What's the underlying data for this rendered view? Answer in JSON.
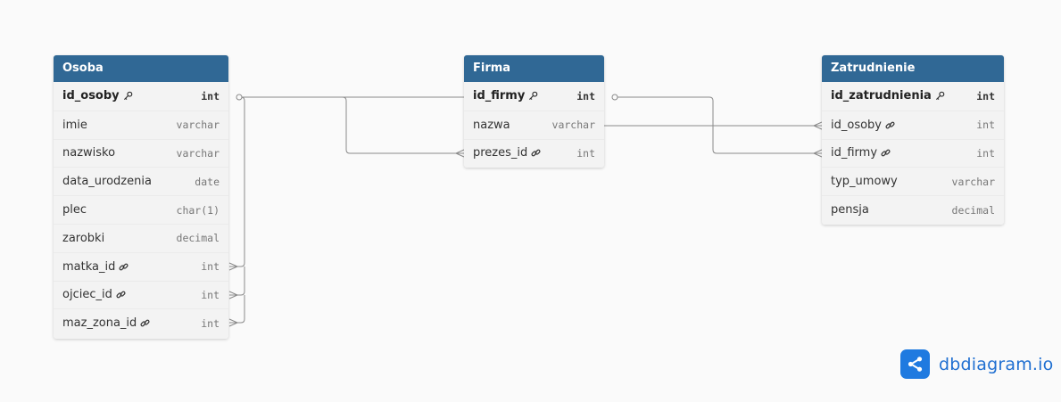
{
  "tables": {
    "osoba": {
      "name": "Osoba",
      "columns": [
        {
          "name": "id_osoby",
          "type": "int",
          "pk": true
        },
        {
          "name": "imie",
          "type": "varchar"
        },
        {
          "name": "nazwisko",
          "type": "varchar"
        },
        {
          "name": "data_urodzenia",
          "type": "date"
        },
        {
          "name": "plec",
          "type": "char(1)"
        },
        {
          "name": "zarobki",
          "type": "decimal"
        },
        {
          "name": "matka_id",
          "type": "int",
          "fk": true
        },
        {
          "name": "ojciec_id",
          "type": "int",
          "fk": true
        },
        {
          "name": "maz_zona_id",
          "type": "int",
          "fk": true
        }
      ]
    },
    "firma": {
      "name": "Firma",
      "columns": [
        {
          "name": "id_firmy",
          "type": "int",
          "pk": true
        },
        {
          "name": "nazwa",
          "type": "varchar"
        },
        {
          "name": "prezes_id",
          "type": "int",
          "fk": true
        }
      ]
    },
    "zatrudnienie": {
      "name": "Zatrudnienie",
      "columns": [
        {
          "name": "id_zatrudnienia",
          "type": "int",
          "pk": true
        },
        {
          "name": "id_osoby",
          "type": "int",
          "fk": true
        },
        {
          "name": "id_firmy",
          "type": "int",
          "fk": true
        },
        {
          "name": "typ_umowy",
          "type": "varchar"
        },
        {
          "name": "pensja",
          "type": "decimal"
        }
      ]
    }
  },
  "relations": [
    {
      "from": "osoba.id_osoby",
      "to": "osoba.matka_id",
      "type": "one-to-many"
    },
    {
      "from": "osoba.id_osoby",
      "to": "osoba.ojciec_id",
      "type": "one-to-many"
    },
    {
      "from": "osoba.id_osoby",
      "to": "osoba.maz_zona_id",
      "type": "one-to-many"
    },
    {
      "from": "osoba.id_osoby",
      "to": "firma.prezes_id",
      "type": "one-to-many"
    },
    {
      "from": "osoba.id_osoby",
      "to": "zatrudnienie.id_osoby",
      "type": "one-to-many"
    },
    {
      "from": "firma.id_firmy",
      "to": "zatrudnienie.id_firmy",
      "type": "one-to-many"
    }
  ],
  "brand": {
    "name": "dbdiagram.io",
    "color": "#1f7ae0"
  },
  "colors": {
    "header": "#306895",
    "table_bg": "#f3f3f3",
    "link": "#8a8a8a"
  }
}
